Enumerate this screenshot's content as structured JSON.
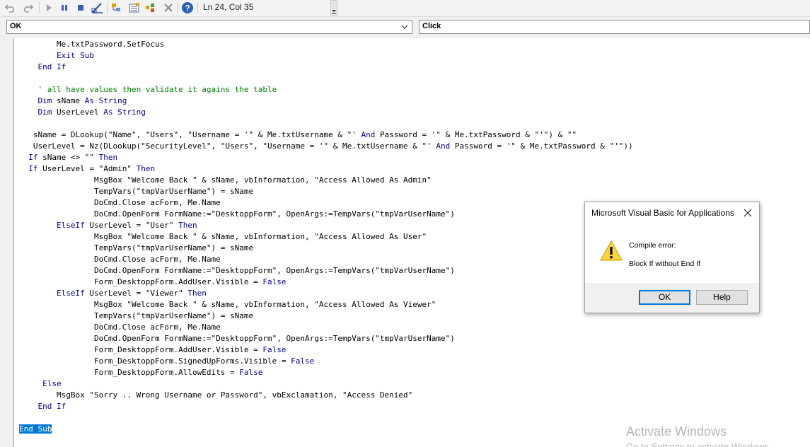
{
  "toolbar": {
    "icons": [
      "undo-icon",
      "redo-icon",
      "run-icon",
      "break-icon",
      "reset-icon",
      "design-mode-icon",
      "project-explorer-icon",
      "properties-window-icon",
      "object-browser-icon",
      "toolbox-icon",
      "help-icon"
    ],
    "position": "Ln 24, Col 35"
  },
  "object_combo": {
    "value": "OK"
  },
  "procedure_combo": {
    "value": "Click"
  },
  "code": [
    [
      [
        "",
        "        Me.txtPassword.SetFocus"
      ]
    ],
    [
      [
        "kw",
        "        Exit Sub"
      ]
    ],
    [
      [
        "kw",
        "    End If"
      ]
    ],
    [
      [
        "",
        ""
      ]
    ],
    [
      [
        "cm",
        "    ' all have values then validate it agains the table"
      ]
    ],
    [
      [
        "kw",
        "    Dim "
      ],
      [
        "",
        "sName "
      ],
      [
        "kw",
        "As String"
      ]
    ],
    [
      [
        "kw",
        "    Dim "
      ],
      [
        "",
        "UserLevel "
      ],
      [
        "kw",
        "As String"
      ]
    ],
    [
      [
        "",
        ""
      ]
    ],
    [
      [
        "",
        "   sName = DLookup(\"Name\", \"Users\", \"Username = '\" & Me.txtUsername & \"' "
      ],
      [
        "kw",
        "And"
      ],
      [
        "",
        " Password = '\" & Me.txtPassword & \"'\") & \"\""
      ]
    ],
    [
      [
        "",
        "   UserLevel = Nz(DLookup(\"SecurityLevel\", \"Users\", \"Username = '\" & Me.txtUsername & \"' "
      ],
      [
        "kw",
        "And"
      ],
      [
        "",
        " Password = '\" & Me.txtPassword & \"'\"))"
      ]
    ],
    [
      [
        "kw",
        "  If "
      ],
      [
        "",
        "sName <> \"\" "
      ],
      [
        "kw",
        "Then"
      ]
    ],
    [
      [
        "kw",
        "  If "
      ],
      [
        "",
        "UserLevel = \"Admin\" "
      ],
      [
        "kw",
        "Then"
      ]
    ],
    [
      [
        "",
        "                MsgBox \"Welcome Back \" & sName, vbInformation, \"Access Allowed As Admin\""
      ]
    ],
    [
      [
        "",
        "                TempVars(\"tmpVarUserName\") = sName"
      ]
    ],
    [
      [
        "",
        "                DoCmd.Close acForm, Me.Name"
      ]
    ],
    [
      [
        "",
        "                DoCmd.OpenForm FormName:=\"DesktoppForm\", OpenArgs:=TempVars(\"tmpVarUserName\")"
      ]
    ],
    [
      [
        "kw",
        "        ElseIf "
      ],
      [
        "",
        "UserLevel = \"User\" "
      ],
      [
        "kw",
        "Then"
      ]
    ],
    [
      [
        "",
        "                MsgBox \"Welcome Back \" & sName, vbInformation, \"Access Allowed As User\""
      ]
    ],
    [
      [
        "",
        "                TempVars(\"tmpVarUserName\") = sName"
      ]
    ],
    [
      [
        "",
        "                DoCmd.Close acForm, Me.Name"
      ]
    ],
    [
      [
        "",
        "                DoCmd.OpenForm FormName:=\"DesktoppForm\", OpenArgs:=TempVars(\"tmpVarUserName\")"
      ]
    ],
    [
      [
        "",
        "                Form_DesktoppForm.AddUser.Visible = "
      ],
      [
        "kw",
        "False"
      ]
    ],
    [
      [
        "kw",
        "        ElseIf "
      ],
      [
        "",
        "UserLevel = \"Viewer\" "
      ],
      [
        "kw",
        "Then"
      ]
    ],
    [
      [
        "",
        "                MsgBox \"Welcome Back \" & sName, vbInformation, \"Access Allowed As Viewer\""
      ]
    ],
    [
      [
        "",
        "                TempVars(\"tmpVarUserName\") = sName"
      ]
    ],
    [
      [
        "",
        "                DoCmd.Close acForm, Me.Name"
      ]
    ],
    [
      [
        "",
        "                DoCmd.OpenForm FormName:=\"DesktoppForm\", OpenArgs:=TempVars(\"tmpVarUserName\")"
      ]
    ],
    [
      [
        "",
        "                Form_DesktoppForm.AddUser.Visible = "
      ],
      [
        "kw",
        "False"
      ]
    ],
    [
      [
        "",
        "                Form_DesktoppForm.SignedUpForms.Visible = "
      ],
      [
        "kw",
        "False"
      ]
    ],
    [
      [
        "",
        "                Form_DesktoppForm.AllowEdits = "
      ],
      [
        "kw",
        "False"
      ]
    ],
    [
      [
        "kw",
        "     Else"
      ]
    ],
    [
      [
        "",
        "        MsgBox \"Sorry .. Wrong Username or Password\", vbExclamation, \"Access Denied\""
      ]
    ],
    [
      [
        "kw",
        "    End If"
      ]
    ],
    [
      [
        "",
        ""
      ]
    ],
    [
      [
        "sel",
        "End Sub"
      ]
    ]
  ],
  "dialog": {
    "title": "Microsoft Visual Basic for Applications",
    "close_icon": "close-icon",
    "warning_icon": "warning-icon",
    "message_line1": "Compile error:",
    "message_line2": "Block If without End If",
    "ok_label": "OK",
    "help_label": "Help"
  },
  "watermark": {
    "line1": "Activate Windows",
    "line2": "Go to Settings to activate Windows."
  }
}
